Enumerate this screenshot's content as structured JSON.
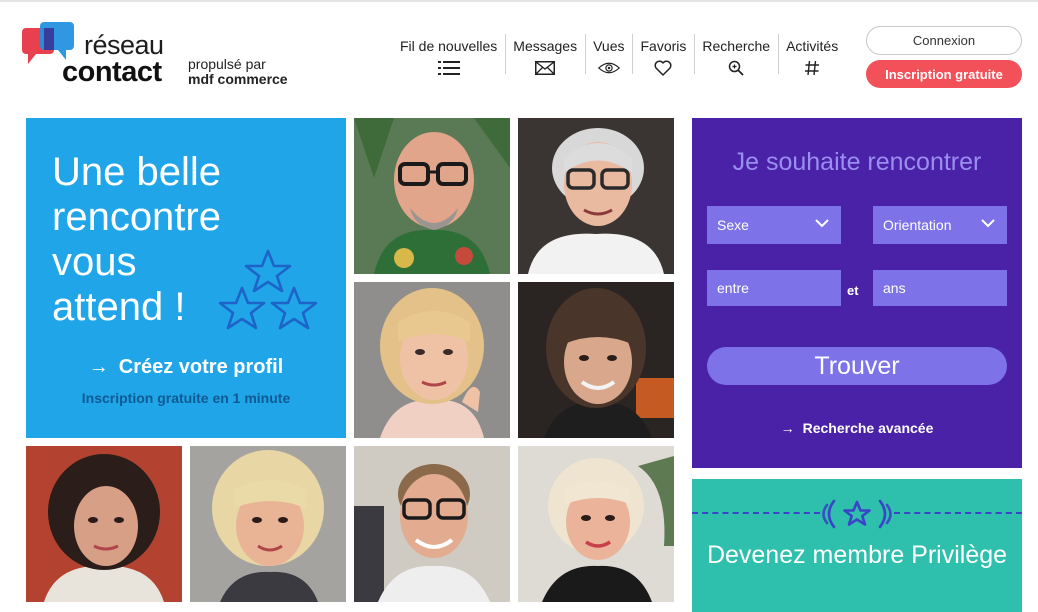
{
  "logo": {
    "word1": "réseau",
    "word2": "contact",
    "powered_line1": "propulsé par",
    "powered_line2": "mdf commerce"
  },
  "nav": [
    {
      "label": "Fil de nouvelles",
      "icon": "list-icon"
    },
    {
      "label": "Messages",
      "icon": "envelope-icon"
    },
    {
      "label": "Vues",
      "icon": "eye-icon"
    },
    {
      "label": "Favoris",
      "icon": "heart-icon"
    },
    {
      "label": "Recherche",
      "icon": "search-icon"
    },
    {
      "label": "Activités",
      "icon": "hashtag-icon"
    }
  ],
  "auth": {
    "login_label": "Connexion",
    "signup_label": "Inscription gratuite"
  },
  "hero": {
    "title": "Une belle rencontre vous attend !",
    "cta_label": "Créez votre profil",
    "cta_arrow": "→",
    "subtitle": "Inscription gratuite en 1 minute"
  },
  "search": {
    "title": "Je souhaite rencontrer",
    "sex_select": "Sexe",
    "orientation_select": "Orientation",
    "age_from_placeholder": "entre",
    "age_joiner": "et",
    "age_to_placeholder": "ans",
    "submit_label": "Trouver",
    "advanced_label": "Recherche avancée",
    "advanced_arrow": "→"
  },
  "privilege": {
    "title": "Devenez membre Privilège"
  },
  "colors": {
    "hero_blue": "#1fa5e8",
    "search_purple": "#4a22a8",
    "control_violet": "#7d72e8",
    "privilege_teal": "#2fbfad",
    "signup_red": "#f2515a"
  }
}
